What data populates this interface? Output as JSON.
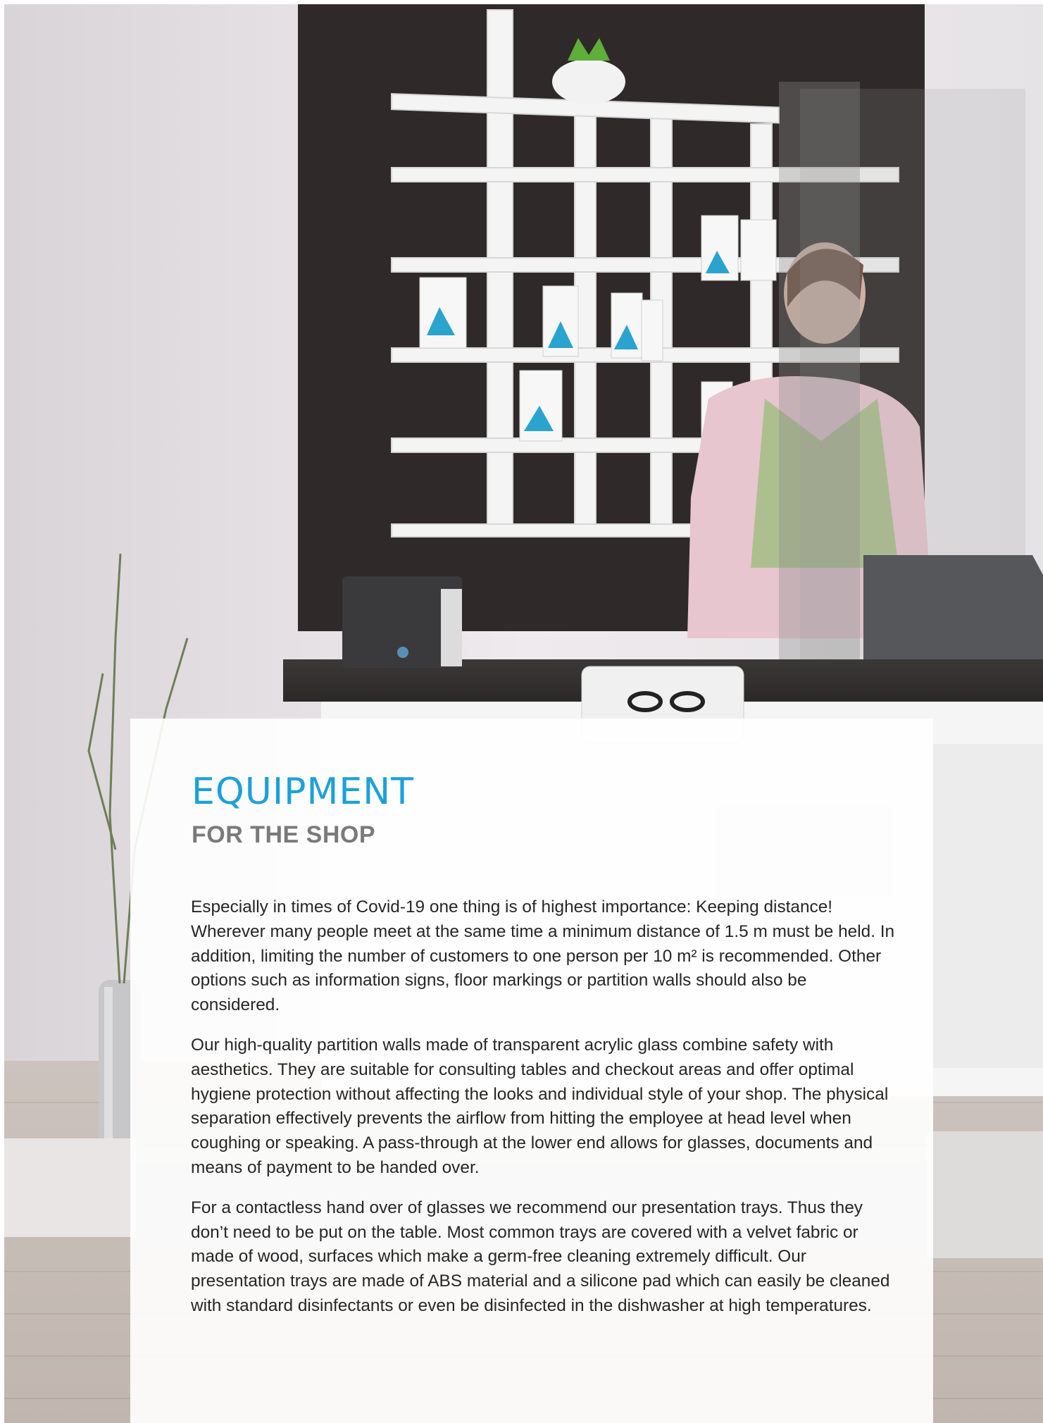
{
  "heading": {
    "title": "EQUIPMENT",
    "subtitle": "FOR THE SHOP"
  },
  "paragraphs": [
    "Especially in times of Covid-19 one thing is of highest importance: Keeping distance! Wherever many people meet at the same time a minimum distance of 1.5 m must be held. In addition, limiting the number of customers to one person per 10 m² is recommended. Other options such as information signs, floor markings or partition walls should also be considered.",
    "Our high-quality partition walls made of transparent acrylic glass combine safety with aesthetics. They are suitable for consulting tables and checkout areas and offer optimal hygiene protection without affecting the looks and individual style of your shop. The physical separation effectively prevents the airflow from hitting the employee at head level when coughing or speaking. A pass-through at the lower end allows for glasses, documents and means of payment to be handed over.",
    "For a contactless hand over of glasses we recommend our presentation trays. Thus they don’t need to be put on the table. Most common trays are covered with a velvet fabric or made of wood, surfaces which make a germ-free cleaning extremely difficult. Our presentation trays are made of ABS material and a silicone pad which can easily be cleaned with standard disinfectants or even be disinfected in the dishwasher at high temperatures."
  ],
  "colors": {
    "title": "#1da0db",
    "subtitle": "#7a7a7a",
    "body": "#262626",
    "wall_panel": "#2f2a29"
  },
  "illustration": "shop-interior-photo"
}
